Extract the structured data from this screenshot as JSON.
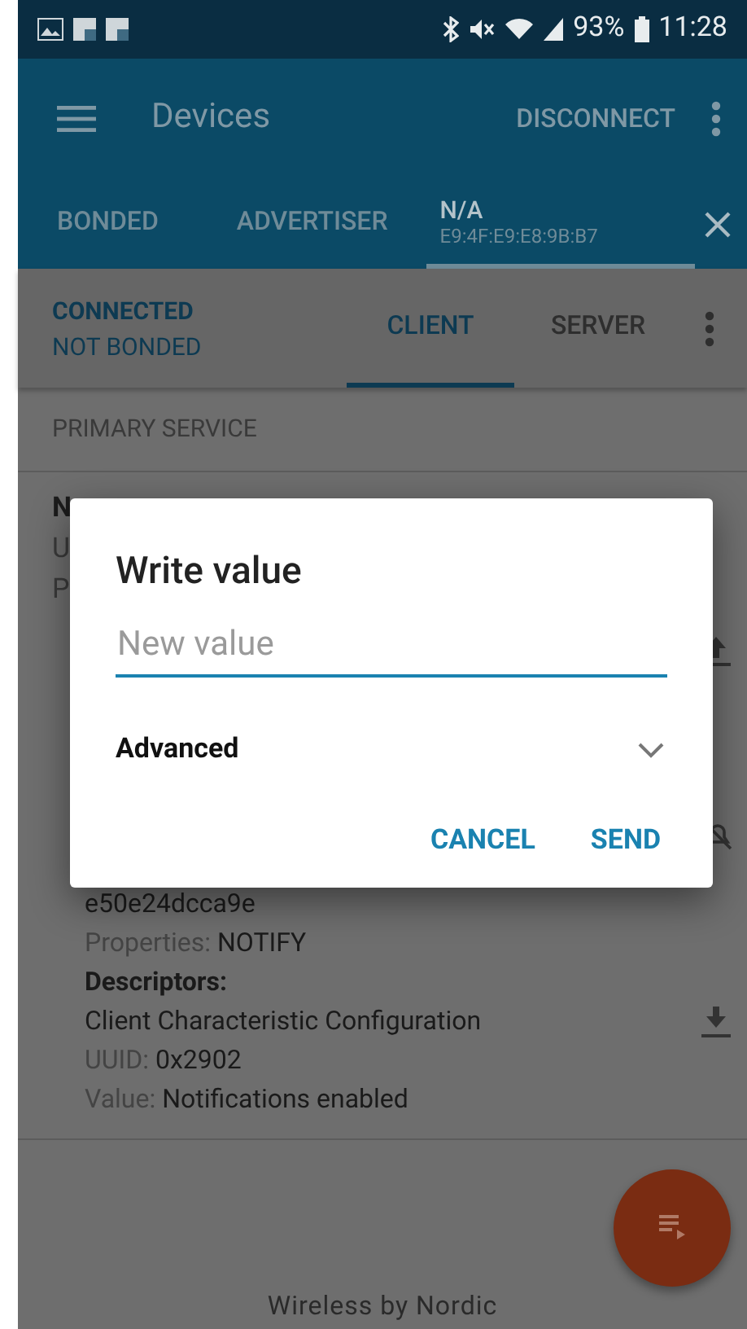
{
  "status_bar": {
    "battery": "93%",
    "time": "11:28"
  },
  "toolbar": {
    "title": "Devices",
    "action": "DISCONNECT"
  },
  "device_tabs": [
    {
      "label": "BONDED",
      "selected": false
    },
    {
      "label": "ADVERTISER",
      "selected": false
    },
    {
      "label": "N/A",
      "address": "E9:4F:E9:E8:9B:B7",
      "selected": true
    }
  ],
  "connection": {
    "state": "CONNECTED",
    "bond": "NOT BONDED"
  },
  "view_tabs": [
    {
      "label": "CLIENT",
      "selected": true
    },
    {
      "label": "SERVER",
      "selected": false
    }
  ],
  "service": {
    "type": "PRIMARY SERVICE",
    "covered_fragments": [
      "N",
      "U",
      "P"
    ]
  },
  "characteristic": {
    "uuid_tail": "e50e24dcca9e",
    "properties_label": "Properties:",
    "properties": "NOTIFY",
    "descriptors_label": "Descriptors:"
  },
  "descriptor": {
    "name": "Client Characteristic Configuration",
    "uuid_label": "UUID:",
    "uuid": "0x2902",
    "value_label": "Value:",
    "value": "Notifications enabled"
  },
  "dialog": {
    "title": "Write value",
    "placeholder": "New value",
    "advanced": "Advanced",
    "expanded": false,
    "buttons": [
      "CANCEL",
      "SEND"
    ]
  },
  "footer": "Wireless by Nordic"
}
